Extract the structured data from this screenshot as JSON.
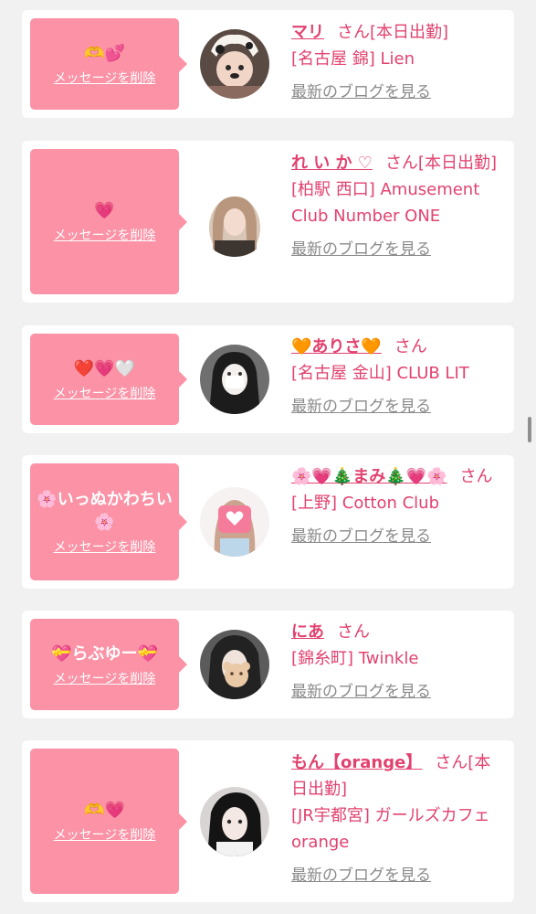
{
  "labels": {
    "delete_message": "メッセージを削除",
    "latest_blog": "最新のブログを見る"
  },
  "colors": {
    "accent": "#e2426f",
    "bubble": "#fb92a6",
    "link_gray": "#8a8a8a",
    "background": "#f1f1f1"
  },
  "cards": [
    {
      "message": "🫶💕",
      "name": "マリ",
      "suffix": "さん[本日出勤]",
      "shop": "[名古屋 錦] Lien",
      "avatar": "woman-with-dog-filter-photo"
    },
    {
      "message": "💗",
      "name": "れ い か ♡",
      "suffix": "さん[本日出勤]",
      "shop": "[柏駅 西口] Amusement Club Number ONE",
      "avatar": "woman-selfie-photo"
    },
    {
      "message": "❤️💗🤍",
      "name": "🧡ありさ🧡",
      "suffix": "さん",
      "shop": "[名古屋 金山] CLUB LIT",
      "avatar": "woman-portrait-photo"
    },
    {
      "message": "🌸いっぬかわちい🌸",
      "name": "🌸💗🎄まみ🎄💗🌸",
      "suffix": "さん",
      "shop": "[上野] Cotton Club",
      "avatar": "woman-heart-covered-face-photo"
    },
    {
      "message": "💝らぶゆー💝",
      "name": "にあ",
      "suffix": "さん",
      "shop": "[錦糸町] Twinkle",
      "avatar": "woman-bear-sticker-photo"
    },
    {
      "message": "🫶💗",
      "name": "もん【orange】",
      "suffix": "さん[本日出勤]",
      "shop": "[JR宇都宮] ガールズカフェ orange",
      "avatar": "woman-black-hair-photo"
    }
  ]
}
